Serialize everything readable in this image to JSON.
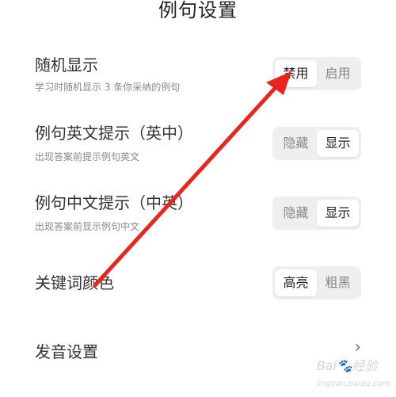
{
  "page": {
    "title": "例句设置"
  },
  "settings": [
    {
      "title": "随机显示",
      "subtitle": "学习时随机显示 3 条你采纳的例句",
      "options": [
        "禁用",
        "启用"
      ],
      "selected": 0
    },
    {
      "title": "例句英文提示（英中）",
      "subtitle": "出现答案前提示例句英文",
      "options": [
        "隐藏",
        "显示"
      ],
      "selected": 1
    },
    {
      "title": "例句中文提示（中英）",
      "subtitle": "出现答案前显示例句中文",
      "options": [
        "隐藏",
        "显示"
      ],
      "selected": 1
    },
    {
      "title": "关键词颜色",
      "options": [
        "高亮",
        "粗黑"
      ],
      "selected": 0
    },
    {
      "title": "发音设置",
      "chevron": "chevron-right-icon"
    }
  ],
  "watermark": {
    "brand": "Bai",
    "paw": "🐾",
    "brand2": "经验",
    "url": "jingyan.baidu.com"
  },
  "annotation": {
    "arrow_color": "#e8261e"
  }
}
